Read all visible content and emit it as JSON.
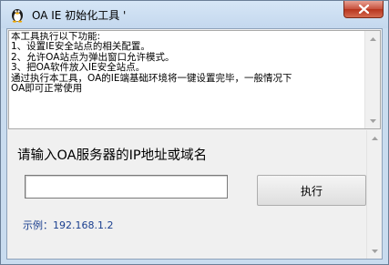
{
  "window": {
    "title": "OA IE 初始化工具 '",
    "icon": "penguin-icon",
    "close_icon": "close-icon"
  },
  "info": {
    "text": "本工具执行以下功能:\n1、设置IE安全站点的相关配置。\n2、允许OA站点为弹出窗口允许模式。\n3、把OA软件放入IE安全站点。\n通过执行本工具，OA的IE端基础环境将一键设置完毕，一般情况下\nOA即可正常使用"
  },
  "form": {
    "prompt": "请输入OA服务器的IP地址或域名",
    "ip_value": "",
    "execute_label": "执行",
    "example": "示例：192.168.1.2"
  },
  "colors": {
    "frame": "#c9dcef",
    "close_button": "#c7513c",
    "example_text": "#1a3f8f"
  }
}
